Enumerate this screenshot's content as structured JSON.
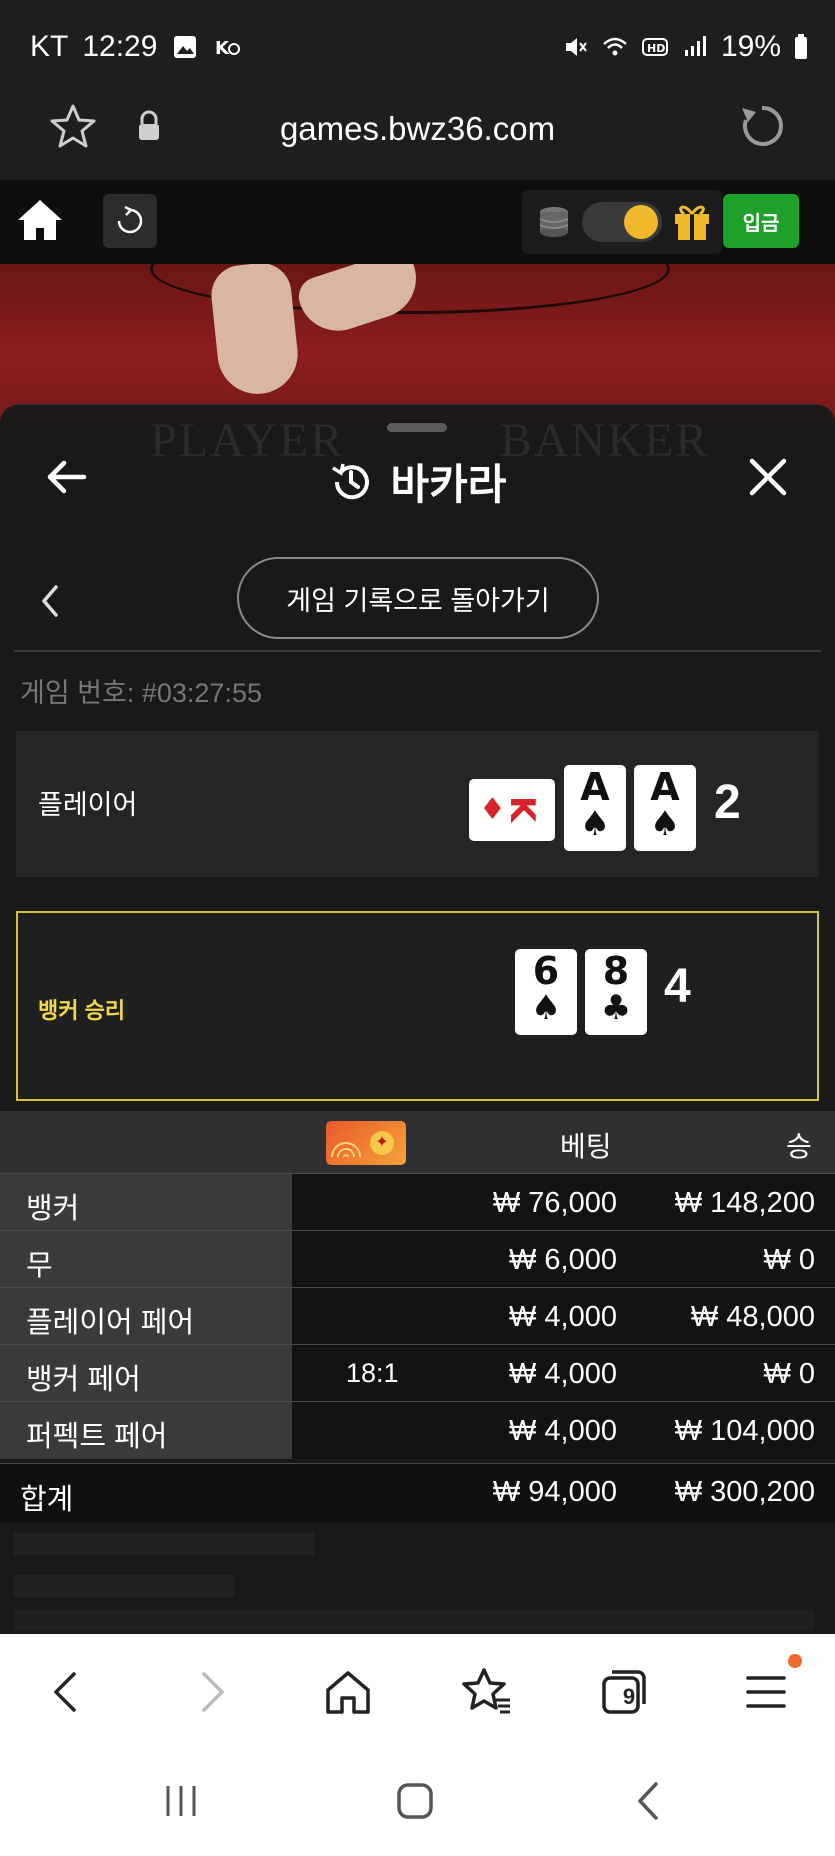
{
  "status": {
    "carrier": "KT",
    "time": "12:29",
    "battery": "19%"
  },
  "browser": {
    "url": "games.bwz36.com",
    "tab_count": "9"
  },
  "game_toolbar": {
    "deposit_label": "입금"
  },
  "modal": {
    "title": "바카라",
    "return_label": "게임 기록으로 돌아가기",
    "game_number": "게임 번호: #03:27:55"
  },
  "result": {
    "player": {
      "label": "플레이어",
      "score": "2",
      "cards": [
        {
          "rank": "K",
          "suit": "♦"
        },
        {
          "rank": "A",
          "suit": "♠"
        },
        {
          "rank": "A",
          "suit": "♠"
        }
      ]
    },
    "banker": {
      "label": "뱅커 승리",
      "score": "4",
      "cards": [
        {
          "rank": "6",
          "suit": "♠"
        },
        {
          "rank": "8",
          "suit": "♣"
        }
      ]
    }
  },
  "bets": {
    "header_bet": "베팅",
    "header_win": "승",
    "rows": [
      {
        "label": "뱅커",
        "odds": "",
        "amount": "₩ 76,000",
        "win": "₩ 148,200"
      },
      {
        "label": "무",
        "odds": "",
        "amount": "₩ 6,000",
        "win": "₩ 0"
      },
      {
        "label": "플레이어 페어",
        "odds": "",
        "amount": "₩ 4,000",
        "win": "₩ 48,000"
      },
      {
        "label": "뱅커 페어",
        "odds": "18:1",
        "amount": "₩ 4,000",
        "win": "₩ 0"
      },
      {
        "label": "퍼펙트 페어",
        "odds": "",
        "amount": "₩ 4,000",
        "win": "₩ 104,000"
      }
    ],
    "total": {
      "label": "합계",
      "amount": "₩ 94,000",
      "win": "₩ 300,200"
    }
  },
  "colors": {
    "accent_green": "#1da12b",
    "win_yellow": "#f3d94a",
    "gold": "#f0b92e"
  }
}
